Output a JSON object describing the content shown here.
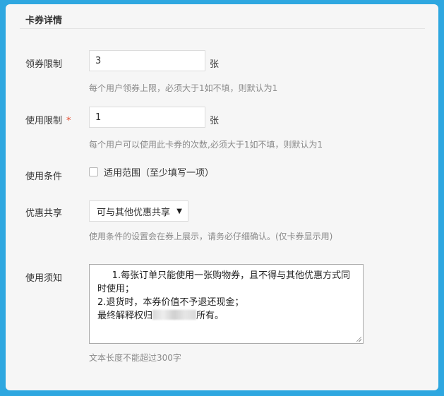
{
  "section": {
    "title": "卡券详情"
  },
  "claim_limit": {
    "label": "领券限制",
    "value": "3",
    "unit": "张",
    "hint": "每个用户领券上限，必须大于1如不填，则默认为1"
  },
  "use_limit": {
    "label": "使用限制",
    "required_mark": "*",
    "value": "1",
    "unit": "张",
    "hint": "每个用户可以使用此卡券的次数,必须大于1如不填，则默认为1"
  },
  "use_condition": {
    "label": "使用条件",
    "checkbox_label": "适用范围（至少填写一项）",
    "checked": false
  },
  "discount_share": {
    "label": "优惠共享",
    "selected": "可与其他优惠共享",
    "hint": "使用条件的设置会在券上展示，请务必仔细确认。(仅卡券显示用)"
  },
  "usage_notes": {
    "label": "使用须知",
    "line1": "     1.每张订单只能使用一张购物券，且不得与其他优惠方式同时使用；",
    "line2": "2.退货时，本券价值不予退还现金；",
    "line3_prefix": "最终解释权归",
    "line3_suffix": "所有。",
    "hint": "文本长度不能超过300字"
  },
  "colors": {
    "frame_border": "#2ea7e0",
    "required": "#e34b2e",
    "hint_text": "#8a8a8a"
  }
}
